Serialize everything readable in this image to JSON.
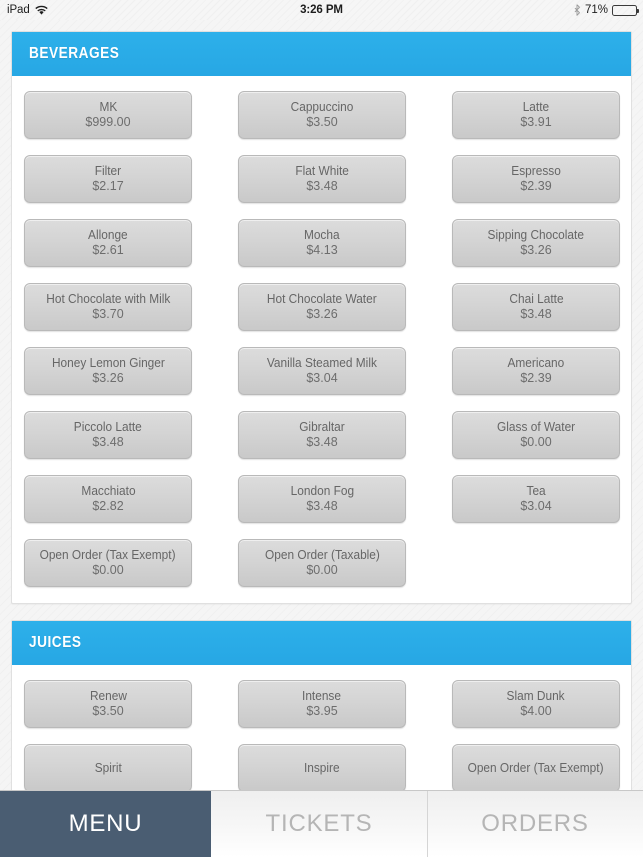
{
  "status_bar": {
    "device_label": "iPad",
    "wifi_icon": "wifi-icon",
    "time": "3:26 PM",
    "bluetooth_icon": "bluetooth-icon",
    "battery_percent": "71%",
    "battery_icon": "battery-icon"
  },
  "theme": {
    "section_header_blue": "#29abe8",
    "active_tab_slate": "#4a5d72",
    "button_gray": "#d4d4d4",
    "page_background": "#f5f5f5"
  },
  "sections": [
    {
      "title": "BEVERAGES",
      "items": [
        {
          "name": "MK",
          "price": "$999.00"
        },
        {
          "name": "Cappuccino",
          "price": "$3.50"
        },
        {
          "name": "Latte",
          "price": "$3.91"
        },
        {
          "name": "Filter",
          "price": "$2.17"
        },
        {
          "name": "Flat White",
          "price": "$3.48"
        },
        {
          "name": "Espresso",
          "price": "$2.39"
        },
        {
          "name": "Allonge",
          "price": "$2.61"
        },
        {
          "name": "Mocha",
          "price": "$4.13"
        },
        {
          "name": "Sipping Chocolate",
          "price": "$3.26"
        },
        {
          "name": "Hot Chocolate with Milk",
          "price": "$3.70"
        },
        {
          "name": "Hot Chocolate Water",
          "price": "$3.26"
        },
        {
          "name": "Chai Latte",
          "price": "$3.48"
        },
        {
          "name": "Honey Lemon Ginger",
          "price": "$3.26"
        },
        {
          "name": "Vanilla Steamed Milk",
          "price": "$3.04"
        },
        {
          "name": "Americano",
          "price": "$2.39"
        },
        {
          "name": "Piccolo Latte",
          "price": "$3.48"
        },
        {
          "name": "Gibraltar",
          "price": "$3.48"
        },
        {
          "name": "Glass of Water",
          "price": "$0.00"
        },
        {
          "name": "Macchiato",
          "price": "$2.82"
        },
        {
          "name": "London Fog",
          "price": "$3.48"
        },
        {
          "name": "Tea",
          "price": "$3.04"
        },
        {
          "name": "Open Order (Tax Exempt)",
          "price": "$0.00"
        },
        {
          "name": "Open Order (Taxable)",
          "price": "$0.00"
        }
      ]
    },
    {
      "title": "JUICES",
      "items": [
        {
          "name": "Renew",
          "price": "$3.50"
        },
        {
          "name": "Intense",
          "price": "$3.95"
        },
        {
          "name": "Slam Dunk",
          "price": "$4.00"
        },
        {
          "name": "Spirit",
          "price": ""
        },
        {
          "name": "Inspire",
          "price": ""
        },
        {
          "name": "Open Order (Tax Exempt)",
          "price": ""
        }
      ]
    }
  ],
  "tabs": [
    {
      "label": "MENU",
      "active": true
    },
    {
      "label": "TICKETS",
      "active": false
    },
    {
      "label": "ORDERS",
      "active": false
    }
  ]
}
